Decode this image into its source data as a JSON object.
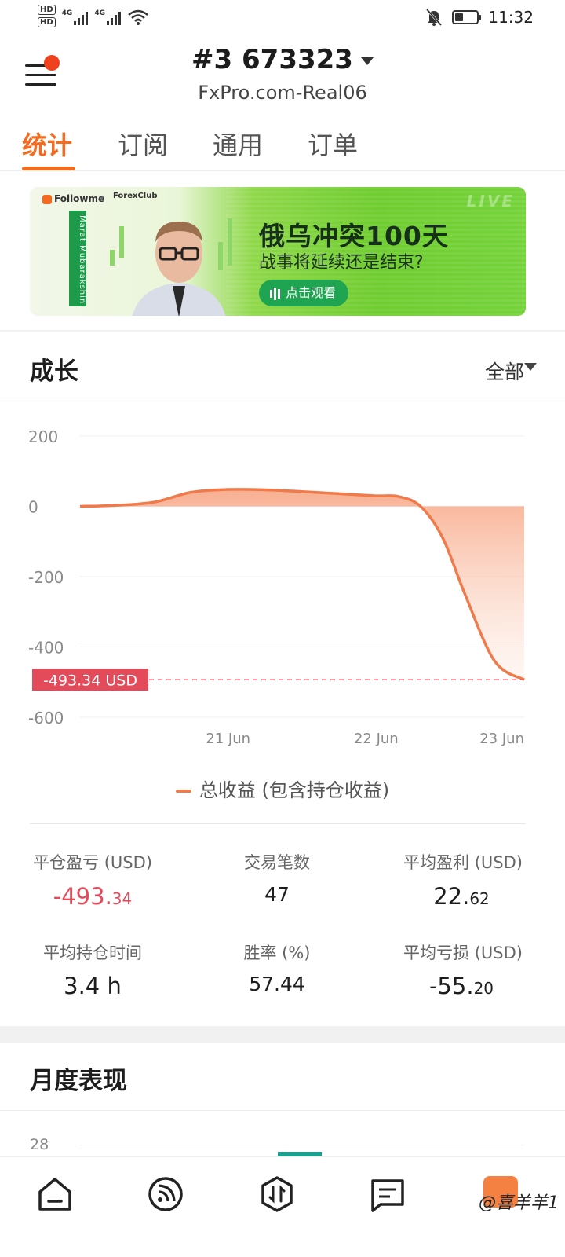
{
  "status_bar": {
    "hd1": "HD",
    "hd2": "HD",
    "net1": "4G",
    "net2": "4G",
    "time": "11:32"
  },
  "header": {
    "account_title": "#3 673323",
    "server": "FxPro.com-Real06"
  },
  "tabs": [
    {
      "label": "统计",
      "active": true
    },
    {
      "label": "订阅",
      "active": false
    },
    {
      "label": "通用",
      "active": false
    },
    {
      "label": "订单",
      "active": false
    }
  ],
  "banner": {
    "brand": "Followme",
    "partner": "ForexClub",
    "presenter": "Marat Mubarakshin",
    "live": "LIVE",
    "title": "俄乌冲突100天",
    "subtitle": "战事将延续还是结束?",
    "button": "点击观看"
  },
  "growth": {
    "title": "成长",
    "range": "全部",
    "current_label": "-493.34 USD",
    "legend": "总收益 (包含持仓收益)"
  },
  "chart_data": {
    "type": "area",
    "title": "",
    "xlabel": "",
    "ylabel": "",
    "ylim": [
      -600,
      200
    ],
    "yticks": [
      200,
      0,
      -200,
      -400,
      -600
    ],
    "xticks": [
      "21 Jun",
      "22 Jun",
      "23 Jun"
    ],
    "grid": true,
    "series": [
      {
        "name": "总收益 (包含持仓收益)",
        "color": "#f07a4a",
        "x": [
          20.0,
          20.25,
          20.5,
          20.75,
          21.0,
          21.25,
          21.5,
          21.75,
          22.0,
          22.15,
          22.3,
          22.45,
          22.6,
          22.8,
          23.0
        ],
        "values": [
          0,
          3,
          12,
          40,
          48,
          47,
          42,
          36,
          30,
          28,
          0,
          -90,
          -250,
          -440,
          -493.34
        ]
      }
    ],
    "reference_line": {
      "value": -493.34,
      "label": "-493.34 USD",
      "color": "#e34a5a"
    }
  },
  "stats": {
    "closed_pnl": {
      "label": "平仓盈亏 (USD)",
      "int": "-493.",
      "dec": "34"
    },
    "trades": {
      "label": "交易笔数",
      "value": "47"
    },
    "avg_profit": {
      "label": "平均盈利 (USD)",
      "int": "22.",
      "dec": "62"
    },
    "avg_hold": {
      "label": "平均持仓时间",
      "value": "3.4 h"
    },
    "win_rate": {
      "label": "胜率 (%)",
      "value": "57.44"
    },
    "avg_loss": {
      "label": "平均亏损 (USD)",
      "int": "-55.",
      "dec": "20"
    }
  },
  "monthly": {
    "title": "月度表现",
    "tick": "28"
  },
  "bottom_nav": {
    "items": [
      "home",
      "subscribe",
      "trade",
      "messages",
      "profile"
    ],
    "watermark": "@喜羊羊1"
  },
  "colors": {
    "accent": "#f26b21",
    "negative": "#e34a5a",
    "series": "#f07a4a"
  }
}
